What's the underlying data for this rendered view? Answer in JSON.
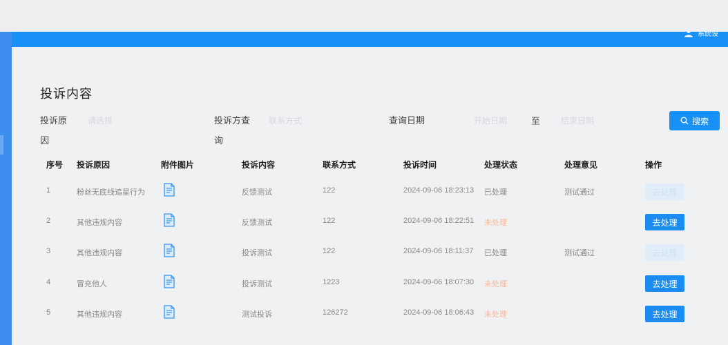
{
  "header": {
    "user_label": "系统设"
  },
  "page": {
    "title": "投诉内容"
  },
  "filters": {
    "reason": {
      "label_line1": "投诉原",
      "label_line2": "因",
      "placeholder": "请选择"
    },
    "contact": {
      "label_line1": "投诉方查",
      "label_line2": "询",
      "placeholder": "联系方式"
    },
    "date": {
      "label": "查询日期",
      "start_placeholder": "开始日期",
      "separator": "至",
      "end_placeholder": "结束日期"
    },
    "search_button": "搜索"
  },
  "table": {
    "columns": [
      "序号",
      "投诉原因",
      "附件图片",
      "投诉内容",
      "联系方式",
      "投诉时间",
      "处理状态",
      "处理意见",
      "操作"
    ],
    "rows": [
      {
        "index": "1",
        "reason": "粉丝无底线追星行为",
        "content": "反馈测试",
        "contact": "122",
        "time": "2024-09-06 18:23:13",
        "status": "已处理",
        "opinion": "测试通过",
        "action": "去处理",
        "pending": false
      },
      {
        "index": "2",
        "reason": "其他违规内容",
        "content": "反馈测试",
        "contact": "122",
        "time": "2024-09-06 18:22:51",
        "status": "未处理",
        "opinion": "",
        "action": "去处理",
        "pending": true
      },
      {
        "index": "3",
        "reason": "其他违规内容",
        "content": "投诉测试",
        "contact": "122",
        "time": "2024-09-06 18:11:37",
        "status": "已处理",
        "opinion": "测试通过",
        "action": "去处理",
        "pending": false
      },
      {
        "index": "4",
        "reason": "冒充他人",
        "content": "投诉测试",
        "contact": "1223",
        "time": "2024-09-06 18:07:30",
        "status": "未处理",
        "opinion": "",
        "action": "去处理",
        "pending": true
      },
      {
        "index": "5",
        "reason": "其他违规内容",
        "content": "测试投诉",
        "contact": "126272",
        "time": "2024-09-06 18:06:43",
        "status": "未处理",
        "opinion": "",
        "action": "去处理",
        "pending": true
      }
    ]
  },
  "icons": {
    "attachment": "document-icon",
    "search": "search-icon",
    "user": "user-icon"
  },
  "colors": {
    "primary": "#1890f5",
    "pending_status": "#f7b898",
    "disabled_button": "#e1eef9"
  }
}
